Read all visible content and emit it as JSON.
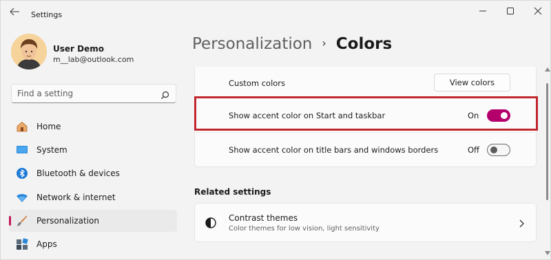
{
  "window": {
    "title": "Settings"
  },
  "user": {
    "name": "User Demo",
    "email": "m__lab@outlook.com"
  },
  "search": {
    "placeholder": "Find a setting"
  },
  "sidebar": {
    "items": [
      {
        "label": "Home",
        "icon": "home-icon"
      },
      {
        "label": "System",
        "icon": "monitor-icon"
      },
      {
        "label": "Bluetooth & devices",
        "icon": "bluetooth-icon"
      },
      {
        "label": "Network & internet",
        "icon": "wifi-icon"
      },
      {
        "label": "Personalization",
        "icon": "paintbrush-icon",
        "active": true
      },
      {
        "label": "Apps",
        "icon": "apps-icon"
      }
    ]
  },
  "breadcrumb": {
    "parent": "Personalization",
    "separator": "›",
    "current": "Colors"
  },
  "colors": {
    "custom_colors_label": "Custom colors",
    "view_colors_label": "View colors",
    "accent_start_label": "Show accent color on Start and taskbar",
    "accent_start_state": "On",
    "accent_title_label": "Show accent color on title bars and windows borders",
    "accent_title_state": "Off",
    "accent_color": "#b3006b",
    "highlight_color": "#c0272d"
  },
  "related": {
    "heading": "Related settings",
    "items": [
      {
        "title": "Contrast themes",
        "description": "Color themes for low vision, light sensitivity",
        "icon": "contrast-icon"
      }
    ]
  }
}
